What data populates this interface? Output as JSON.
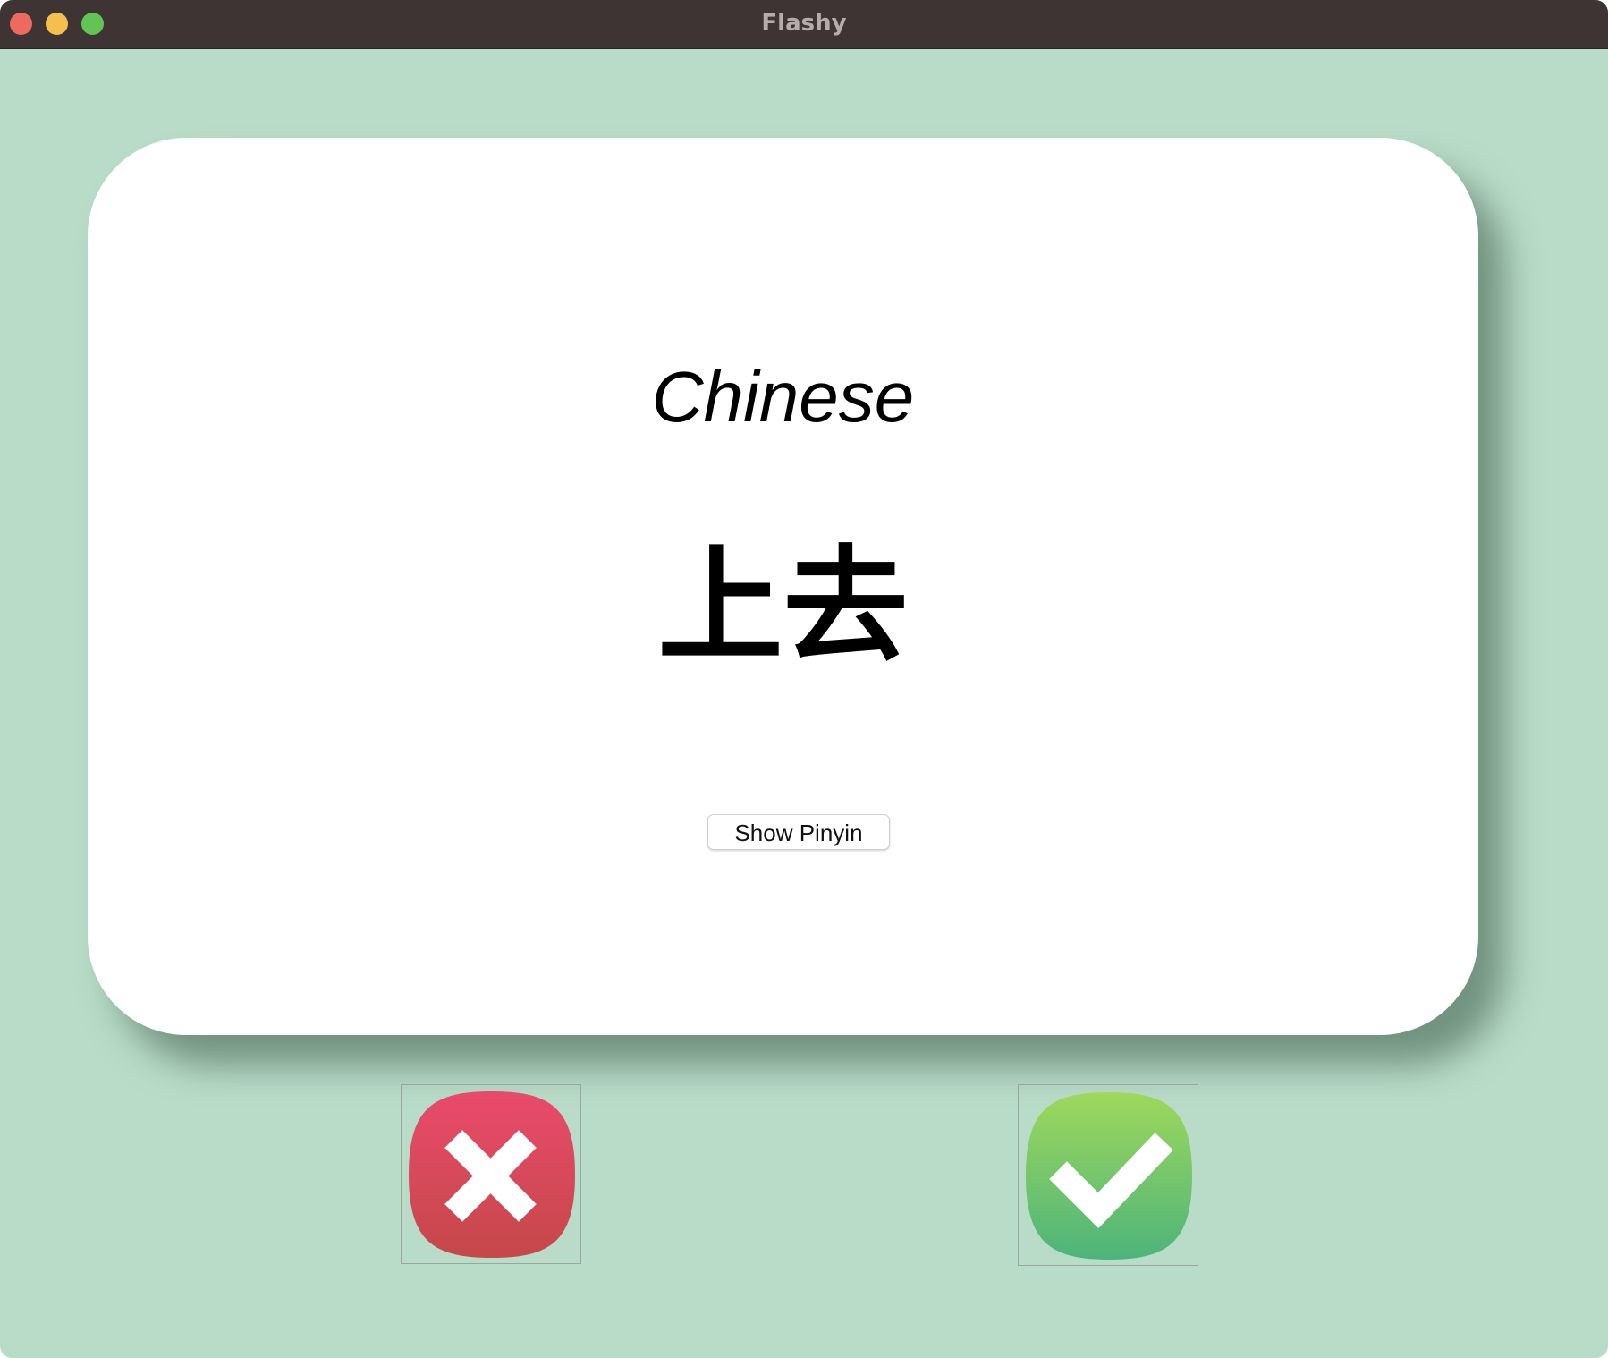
{
  "window": {
    "title": "Flashy"
  },
  "card": {
    "language": "Chinese",
    "word": "上去",
    "show_pinyin_label": "Show Pinyin"
  },
  "actions": {
    "wrong_icon": "wrong-cross-icon",
    "right_icon": "right-check-icon"
  },
  "colors": {
    "background": "#b9dcc8",
    "card": "#ffffff",
    "titlebar": "#3e3434",
    "wrong_top": "#e94a6b",
    "wrong_bottom": "#c5484a",
    "right_top": "#9fd85c",
    "right_bottom": "#4db47b"
  }
}
